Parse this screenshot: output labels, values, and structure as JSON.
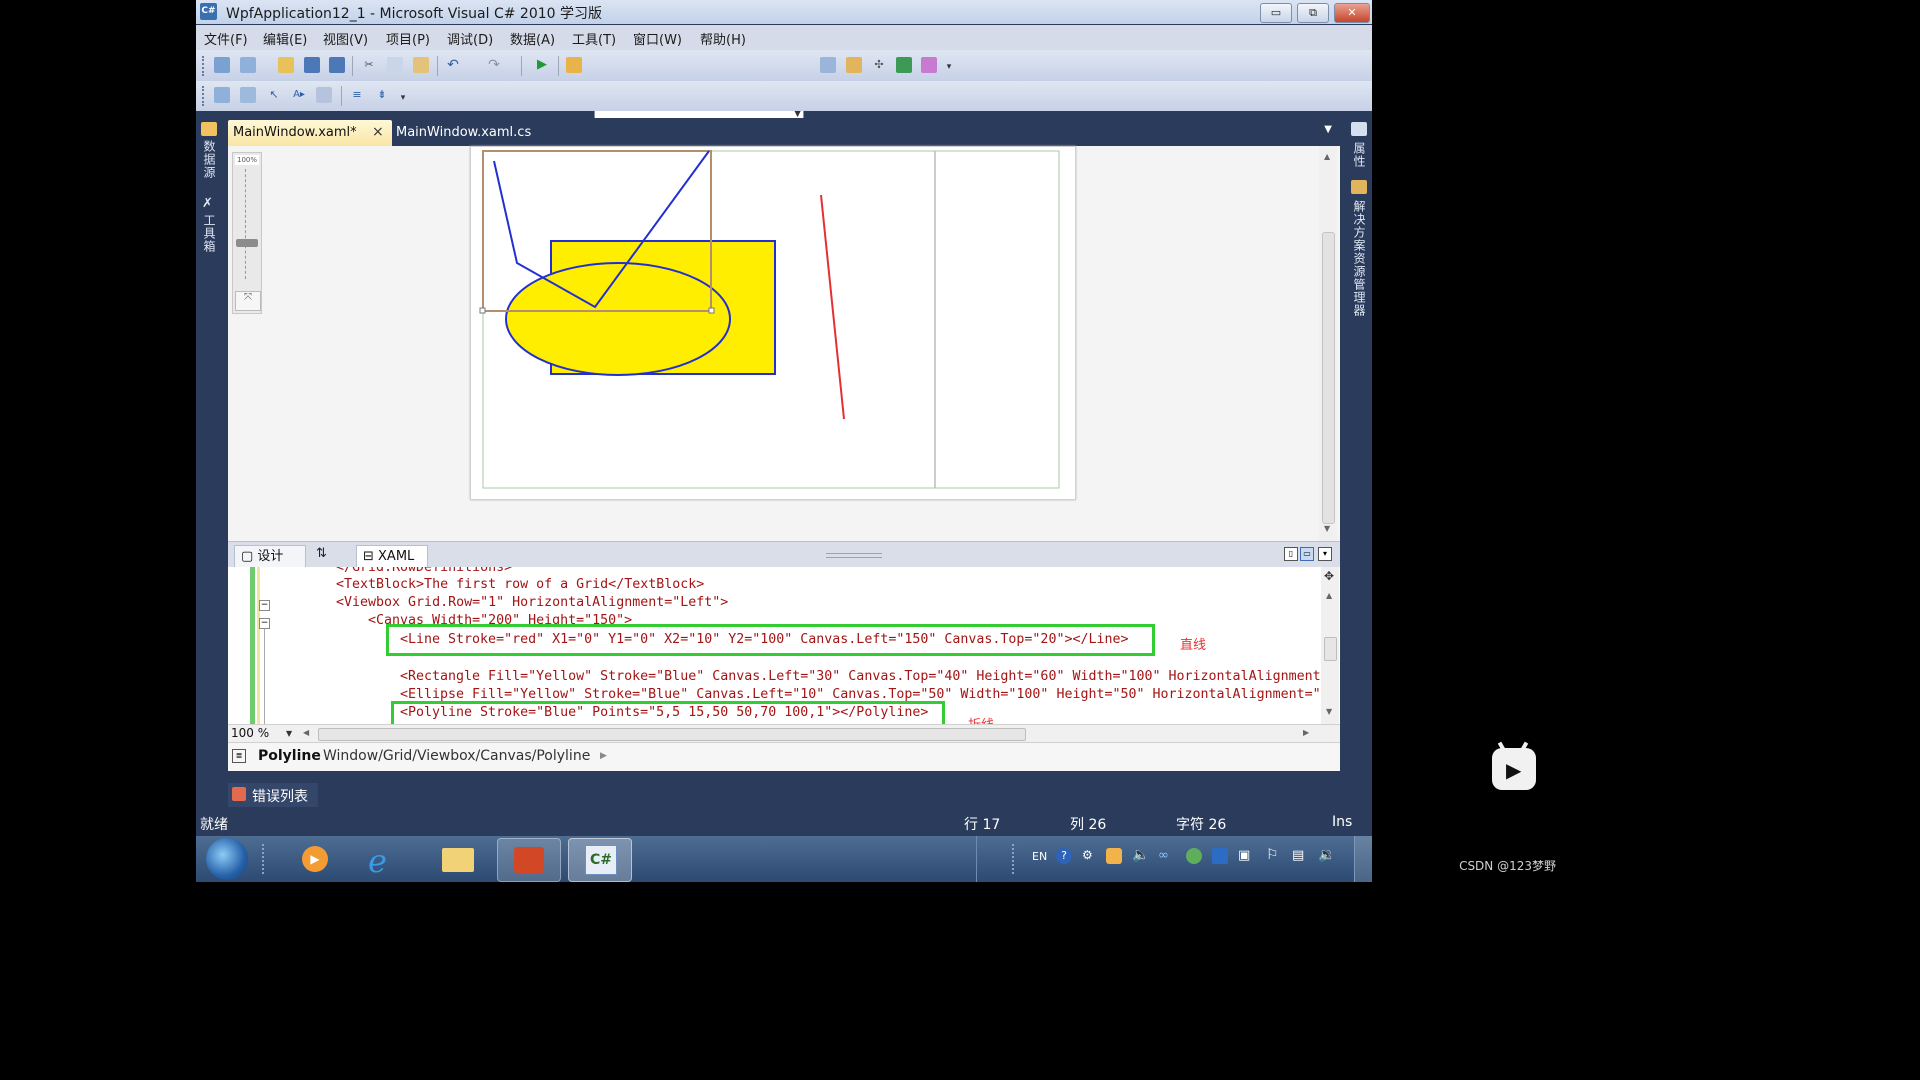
{
  "window": {
    "title": "WpfApplication12_1 - Microsoft Visual C# 2010 学习版",
    "icon_label": "C#",
    "controls": {
      "minimize": "▭",
      "restore": "⧉",
      "close": "✕"
    }
  },
  "menubar": {
    "items": [
      "文件(F)",
      "编辑(E)",
      "视图(V)",
      "项目(P)",
      "调试(D)",
      "数据(A)",
      "工具(T)",
      "窗口(W)",
      "帮助(H)"
    ]
  },
  "left_sidebar": {
    "items": [
      "数据源",
      "工具箱"
    ]
  },
  "right_sidebar": {
    "items": [
      "属性",
      "解决方案资源管理器"
    ]
  },
  "editor_tabs": [
    {
      "label": "MainWindow.xaml*",
      "close": "×",
      "active": true
    },
    {
      "label": "MainWindow.xaml.cs",
      "active": false
    }
  ],
  "designer": {
    "zoom_label": "100%",
    "colors": {
      "line": "#e53030",
      "shape_fill": "#ffee00",
      "shape_stroke": "#2330d0",
      "polyline": "#2330d0"
    }
  },
  "split_tabs": {
    "design": "设计",
    "swap": "⇅",
    "xaml": "XAML"
  },
  "code_lines": [
    {
      "text": "</Grid.RowDefinitions>"
    },
    {
      "text": "<TextBlock>The first row of a Grid</TextBlock>"
    },
    {
      "text": "<Viewbox Grid.Row=\"1\" HorizontalAlignment=\"Left\">"
    },
    {
      "text": "<Canvas Width=\"200\" Height=\"150\">"
    },
    {
      "text": "<Line Stroke=\"red\" X1=\"0\" Y1=\"0\" X2=\"10\" Y2=\"100\" Canvas.Left=\"150\" Canvas.Top=\"20\"></Line>"
    },
    {
      "text": "<Rectangle Fill=\"Yellow\" Stroke=\"Blue\" Canvas.Left=\"30\" Canvas.Top=\"40\" Height=\"60\" Width=\"100\" HorizontalAlignment"
    },
    {
      "text": "<Ellipse Fill=\"Yellow\" Stroke=\"Blue\" Canvas.Left=\"10\" Canvas.Top=\"50\" Width=\"100\" Height=\"50\" HorizontalAlignment=\""
    },
    {
      "text": "<Polyline Stroke=\"Blue\" Points=\"5,5 15,50 50,70 100,1\"></Polyline>"
    }
  ],
  "annotations": {
    "line_note": "直线",
    "polyline_note": "折线"
  },
  "zoom_select": "100 %",
  "path_bar": {
    "element": "Polyline",
    "path": "Window/Grid/Viewbox/Canvas/Polyline"
  },
  "error_list": "错误列表",
  "statusbar": {
    "ready": "就绪",
    "line": "行 17",
    "col": "列 26",
    "char": "字符 26",
    "mode": "Ins"
  },
  "taskbar": {
    "lang": "EN"
  },
  "watermark": "CSDN @123梦野"
}
